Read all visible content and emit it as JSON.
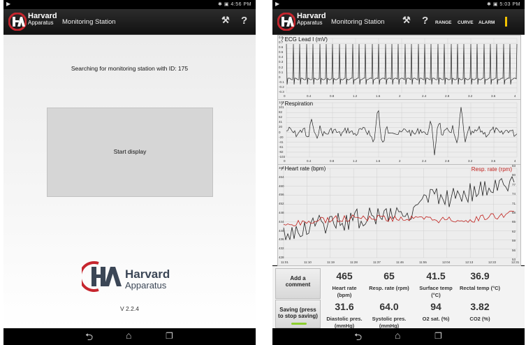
{
  "left_screen": {
    "status": {
      "left_icon": "▶",
      "right_icons": "✱ ▣",
      "time": "4:56 PM"
    },
    "app": {
      "brand_top": "Harvard",
      "brand_bottom": "Apparatus",
      "title": "Monitoring Station",
      "tool_icon": "wrench-icon",
      "help": "?"
    },
    "searching_text": "Searching for monitoring station with ID: 175",
    "start_label": "Start display",
    "logo": {
      "line1": "Harvard",
      "line2": "Apparatus"
    },
    "version": "V 2.2.4",
    "nav": {
      "back": "⮌",
      "home": "⌂",
      "recent": "❐"
    }
  },
  "right_screen": {
    "status": {
      "left_icon": "▶",
      "right_icons": "✱ ▣",
      "time": "5:03 PM"
    },
    "app": {
      "brand_top": "Harvard",
      "brand_bottom": "Apparatus",
      "title": "Monitoring Station",
      "help": "?",
      "range": "RANGE",
      "curve": "CURVE",
      "alarm": "ALARM",
      "alarm_indicator_color": "#f2c200"
    },
    "charts": {
      "ecg": {
        "title": "ECG Lead I (mV)",
        "yticks": [
          "0.8",
          "0.7",
          "0.6",
          "0.5",
          "0.4",
          "0.3",
          "0.2",
          "0.1",
          "0",
          "-0.1",
          "-0.2",
          "-0.3"
        ],
        "xticks": [
          "0",
          "0.4",
          "0.8",
          "1.2",
          "1.6",
          "2",
          "2.4",
          "2.8",
          "3.2",
          "3.6",
          "4"
        ]
      },
      "resp": {
        "title": "Respiration",
        "yticks": [
          "123",
          "101",
          "82",
          "62",
          "41",
          "20",
          "0",
          "-20",
          "-41",
          "-61",
          "-82",
          "-103"
        ],
        "xticks": [
          "0",
          "0.4",
          "0.8",
          "1.2",
          "1.6",
          "2",
          "2.4",
          "2.8",
          "3.2",
          "3.6",
          "4"
        ]
      },
      "hr": {
        "title": "Heart rate (bpm)",
        "title2": "Resp. rate (rpm)",
        "yticks": [
          "468",
          "464",
          "460",
          "456",
          "452",
          "448",
          "444",
          "440",
          "436",
          "432",
          "428"
        ],
        "yticks_right": [
          "83",
          "80",
          "77",
          "74",
          "71",
          "68",
          "65",
          "62",
          "59",
          "56",
          "53"
        ],
        "xticks": [
          "11:01",
          "11:10",
          "11:19",
          "11:28",
          "11:37",
          "11:46",
          "11:55",
          "12:04",
          "12:13",
          "12:22",
          "12:31"
        ],
        "series_colors": {
          "heart_rate": "#222222",
          "resp_rate": "#c0201c"
        }
      }
    },
    "buttons": {
      "comment": [
        "Add a",
        "comment"
      ],
      "saving": [
        "Saving (press",
        "to stop saving)"
      ],
      "saving_indicator_color": "#8ccf2e"
    },
    "metrics": [
      {
        "value": "465",
        "label": [
          "Heart rate",
          "(bpm)"
        ]
      },
      {
        "value": "65",
        "label": [
          "Resp. rate (rpm)"
        ]
      },
      {
        "value": "41.5",
        "label": [
          "Surface temp",
          "(°C)"
        ]
      },
      {
        "value": "36.9",
        "label": [
          "Rectal temp (°C)"
        ]
      },
      {
        "value": "31.6",
        "label": [
          "Diastolic pres.",
          "(mmHg)"
        ]
      },
      {
        "value": "64.0",
        "label": [
          "Systolic pres.",
          "(mmHg)"
        ]
      },
      {
        "value": "94",
        "label": [
          "O2 sat. (%)"
        ]
      },
      {
        "value": "3.82",
        "label": [
          "CO2 (%)"
        ]
      }
    ],
    "nav": {
      "back": "⮌",
      "home": "⌂",
      "recent": "❐"
    }
  }
}
